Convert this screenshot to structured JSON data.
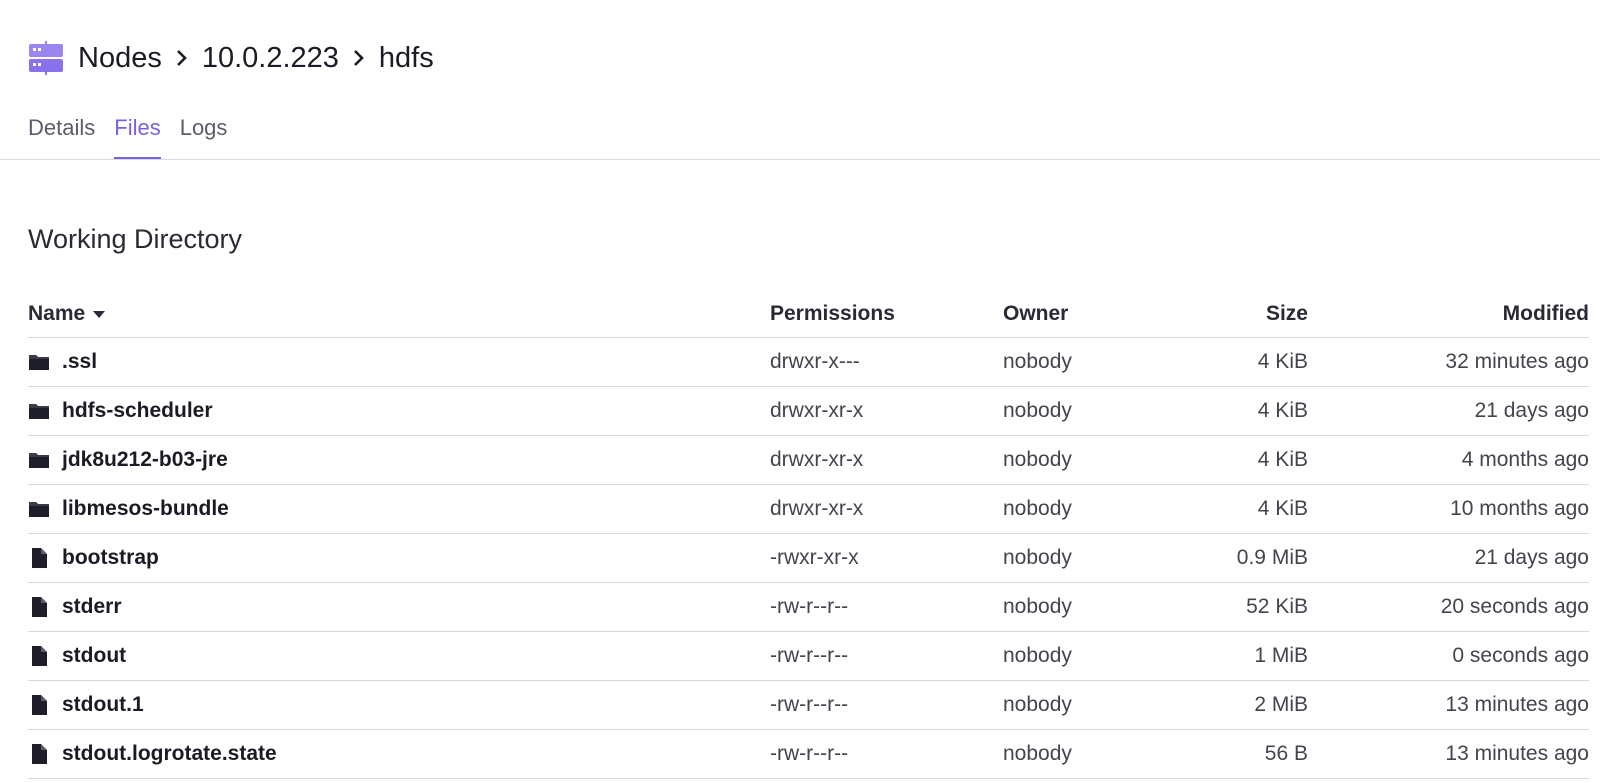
{
  "breadcrumb": {
    "icon": "server-icon",
    "items": [
      "Nodes",
      "10.0.2.223",
      "hdfs"
    ]
  },
  "tabs": [
    {
      "label": "Details",
      "active": false
    },
    {
      "label": "Files",
      "active": true
    },
    {
      "label": "Logs",
      "active": false
    }
  ],
  "section_title": "Working Directory",
  "table": {
    "columns": {
      "name": "Name",
      "permissions": "Permissions",
      "owner": "Owner",
      "size": "Size",
      "modified": "Modified"
    },
    "sort": {
      "column": "Name",
      "direction": "descending-caret"
    },
    "rows": [
      {
        "type": "folder",
        "name": ".ssl",
        "permissions": "drwxr-x---",
        "owner": "nobody",
        "size": "4 KiB",
        "modified": "32 minutes ago"
      },
      {
        "type": "folder",
        "name": "hdfs-scheduler",
        "permissions": "drwxr-xr-x",
        "owner": "nobody",
        "size": "4 KiB",
        "modified": "21 days ago"
      },
      {
        "type": "folder",
        "name": "jdk8u212-b03-jre",
        "permissions": "drwxr-xr-x",
        "owner": "nobody",
        "size": "4 KiB",
        "modified": "4 months ago"
      },
      {
        "type": "folder",
        "name": "libmesos-bundle",
        "permissions": "drwxr-xr-x",
        "owner": "nobody",
        "size": "4 KiB",
        "modified": "10 months ago"
      },
      {
        "type": "file",
        "name": "bootstrap",
        "permissions": "-rwxr-xr-x",
        "owner": "nobody",
        "size": "0.9 MiB",
        "modified": "21 days ago"
      },
      {
        "type": "file",
        "name": "stderr",
        "permissions": "-rw-r--r--",
        "owner": "nobody",
        "size": "52 KiB",
        "modified": "20 seconds ago"
      },
      {
        "type": "file",
        "name": "stdout",
        "permissions": "-rw-r--r--",
        "owner": "nobody",
        "size": "1 MiB",
        "modified": "0 seconds ago"
      },
      {
        "type": "file",
        "name": "stdout.1",
        "permissions": "-rw-r--r--",
        "owner": "nobody",
        "size": "2 MiB",
        "modified": "13 minutes ago"
      },
      {
        "type": "file",
        "name": "stdout.logrotate.state",
        "permissions": "-rw-r--r--",
        "owner": "nobody",
        "size": "56 B",
        "modified": "13 minutes ago"
      }
    ]
  },
  "colors": {
    "accent": "#7b61e0",
    "text": "#1b1b26",
    "muted": "#5c5c6a",
    "border": "#d8d8dc",
    "icon_dark": "#1e1e2a",
    "server_icon": "#9b85f0"
  }
}
